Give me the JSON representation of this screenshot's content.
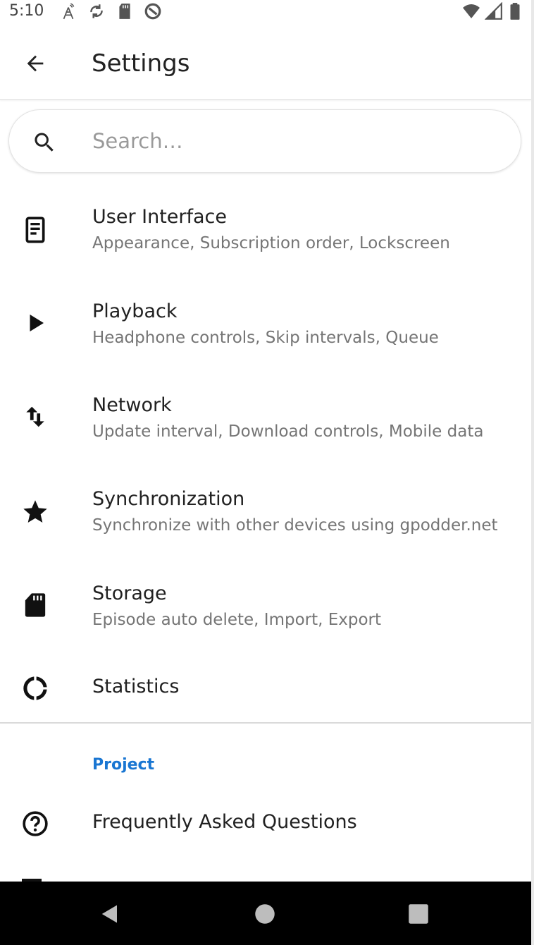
{
  "status_bar": {
    "time": "5:10"
  },
  "toolbar": {
    "title": "Settings"
  },
  "search": {
    "placeholder": "Search…",
    "value": ""
  },
  "settings_items": [
    {
      "icon": "document-icon",
      "title": "User Interface",
      "subtitle": "Appearance, Subscription order, Lockscreen"
    },
    {
      "icon": "play-icon",
      "title": "Playback",
      "subtitle": "Headphone controls, Skip intervals, Queue"
    },
    {
      "icon": "swap-vertical-icon",
      "title": "Network",
      "subtitle": "Update interval, Download controls, Mobile data"
    },
    {
      "icon": "star-icon",
      "title": "Synchronization",
      "subtitle": "Synchronize with other devices using gpodder.net"
    },
    {
      "icon": "sd-card-icon",
      "title": "Storage",
      "subtitle": "Episode auto delete, Import, Export"
    },
    {
      "icon": "statistics-icon",
      "title": "Statistics",
      "subtitle": ""
    }
  ],
  "project_section": {
    "header": "Project",
    "items": [
      {
        "icon": "help-circle-icon",
        "title": "Frequently Asked Questions"
      }
    ]
  },
  "colors": {
    "accent": "#1976d2",
    "text_primary": "#212121",
    "text_secondary": "#757575",
    "nav_bar": "#000000"
  }
}
